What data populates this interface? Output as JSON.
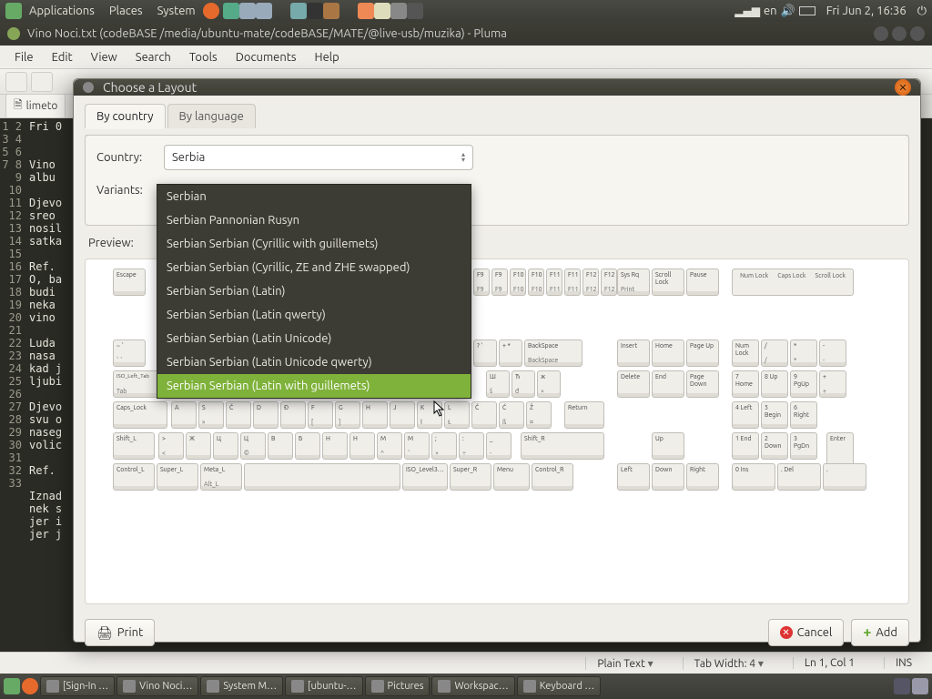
{
  "panel": {
    "menus": [
      "Applications",
      "Places",
      "System"
    ],
    "lang": "en",
    "clock": "Fri Jun  2, 16:36"
  },
  "pluma": {
    "title": "Vino Noci.txt (codeBASE /media/ubuntu-mate/codeBASE/MATE/@live-usb/muzika) - Pluma",
    "menu": [
      "File",
      "Edit",
      "View",
      "Search",
      "Tools",
      "Documents",
      "Help"
    ],
    "tab": "limeto",
    "status": {
      "mode": "Plain Text",
      "tabwidth": "Tab Width: 4",
      "pos": "Ln 1, Col 1",
      "ins": "INS"
    },
    "lines": [
      "Fri 0",
      "",
      "",
      "Vino ",
      "albu",
      "",
      "Djevo",
      "sreo",
      "nosil",
      "satka",
      "",
      "Ref.",
      "O, ba",
      "budi",
      "neka",
      "vino",
      "",
      "Luda",
      "nasa",
      "kad j",
      "ljubi",
      "",
      "Djevo",
      "svu o",
      "naseg",
      "volic",
      "",
      "Ref.",
      "",
      "Iznad",
      "nek s",
      "jer i",
      "jer j"
    ]
  },
  "dialog": {
    "title": "Choose a Layout",
    "tabs": {
      "by_country": "By country",
      "by_language": "By language"
    },
    "labels": {
      "country": "Country:",
      "variants": "Variants:",
      "preview": "Preview:"
    },
    "country_value": "Serbia",
    "variants": [
      "Serbian",
      "Serbian Pannonian Rusyn",
      "Serbian Serbian (Cyrillic with guillemets)",
      "Serbian Serbian (Cyrillic, ZE and ZHE swapped)",
      "Serbian Serbian (Latin)",
      "Serbian Serbian (Latin qwerty)",
      "Serbian Serbian (Latin Unicode)",
      "Serbian Serbian (Latin Unicode qwerty)",
      "Serbian Serbian (Latin with guillemets)"
    ],
    "highlighted_index": 8,
    "buttons": {
      "print": "Print",
      "cancel": "Cancel",
      "add": "Add"
    }
  },
  "keyboard": {
    "escape": "Escape",
    "fn_top": [
      "F9",
      "F9",
      "F10",
      "F10",
      "F11",
      "F11",
      "F12",
      "F12"
    ],
    "fn_bot": [
      "F9",
      "F9",
      "F10",
      "F10",
      "F11",
      "F11",
      "F12",
      "F12"
    ],
    "sys": {
      "sysrq": "Sys Rq",
      "print": "Print",
      "scroll": "Scroll Lock",
      "pause": "Pause"
    },
    "locks": {
      "num": "Num Lock",
      "caps": "Caps Lock",
      "scroll": "Scroll Lock"
    },
    "row1_syms": [
      "?  '",
      "+  *"
    ],
    "backspace": "BackSpace",
    "row1_nav": [
      "Insert",
      "Home",
      "Page Up"
    ],
    "numpad_r1": [
      "Num Lock",
      "/  /",
      "*  *",
      "-  -"
    ],
    "tab": "ISO_Left_Tab\nTab",
    "row2": [
      "Ш  š",
      "Ђ  đ",
      "ж  ×"
    ],
    "row2_nav": [
      "Delete",
      "End",
      "Page Down"
    ],
    "numpad_r2": [
      "7 Home",
      "8 Up",
      "9 PgUp",
      "+  +"
    ],
    "caps": "Caps_Lock",
    "row3": [
      "A",
      "S  »",
      "Č",
      "D",
      "Đ",
      "F  [",
      "G  ]",
      "H",
      "J",
      "K  ł",
      "L  Ł",
      "Č",
      "Ć  ß",
      "Ž  ¤"
    ],
    "return": "Return",
    "numpad_r3": [
      "4 Left",
      "5 Begin",
      "6 Right"
    ],
    "shift_l": "Shift_L",
    "row4": [
      ">  <",
      "Ж",
      "Ц",
      "Ц  ©",
      "B",
      "Б",
      "H",
      "Н",
      "M  ^",
      "М  ˘",
      ";  ×",
      ":  ÷",
      "_  -"
    ],
    "shift_r": "Shift_R",
    "up": "Up",
    "numpad_r4": [
      "1 End",
      "2 Down",
      "3 PgDn"
    ],
    "enter": "Enter",
    "bottom": [
      "Control_L",
      "Super_L",
      "Meta_L\nAlt_L",
      "",
      "ISO_Level3…",
      "Super_R",
      "Menu",
      "Control_R"
    ],
    "arrows": [
      "Left",
      "Down",
      "Right"
    ],
    "numpad_r5": [
      "0 Ins",
      ". Del",
      "."
    ]
  },
  "taskbar": {
    "items": [
      "[Sign-In …",
      "Vino Noci…",
      "System M…",
      "[ubuntu-…",
      "Pictures",
      "Workspac…",
      "Keyboard …"
    ]
  }
}
